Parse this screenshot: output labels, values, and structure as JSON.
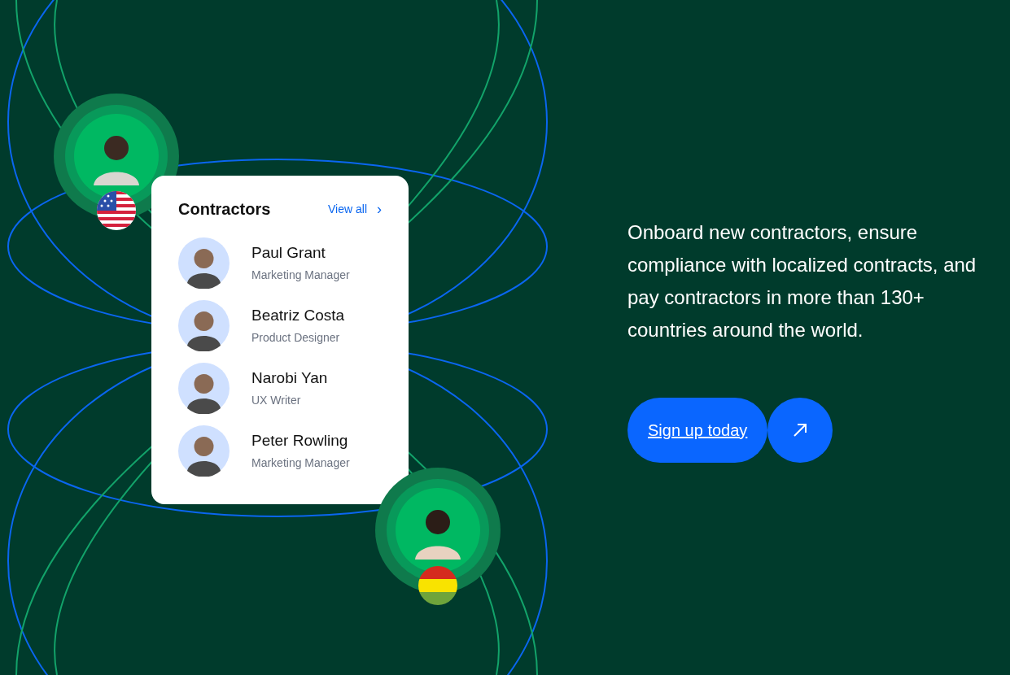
{
  "card": {
    "title": "Contractors",
    "view_all": "View all",
    "chevron": "›",
    "contractors": [
      {
        "name": "Paul Grant",
        "role": "Marketing Manager"
      },
      {
        "name": "Beatriz Costa",
        "role": "Product Designer"
      },
      {
        "name": "Narobi Yan",
        "role": "UX Writer"
      },
      {
        "name": "Peter Rowling",
        "role": "Marketing Manager"
      }
    ]
  },
  "description": "Onboard new contractors, ensure compliance with localized contracts, and pay contractors in more than 130+ countries around the world.",
  "cta": {
    "label": "Sign up today"
  }
}
